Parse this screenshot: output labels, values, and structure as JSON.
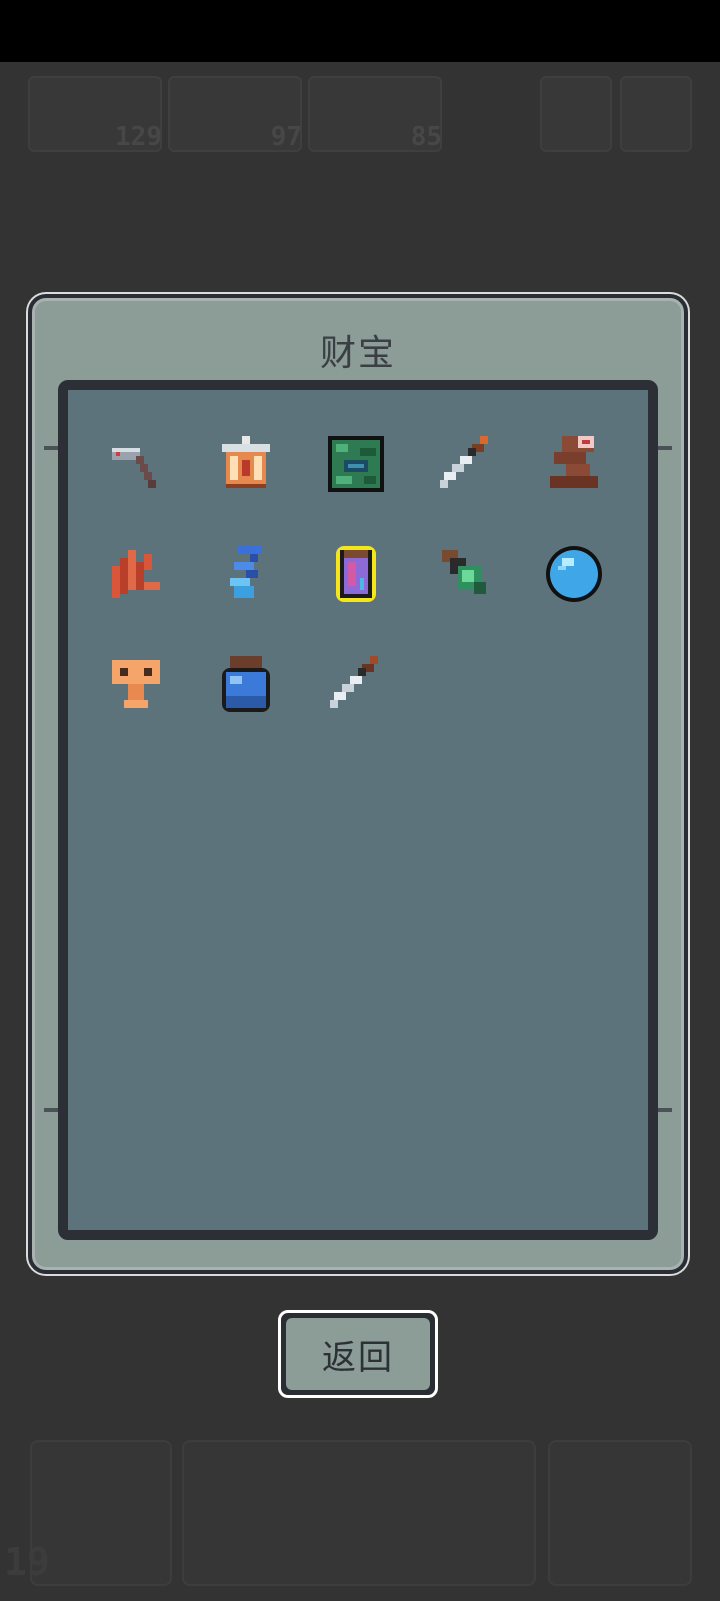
{
  "modal": {
    "title": "财宝"
  },
  "buttons": {
    "back_label": "返回"
  },
  "hud": {
    "counts": [
      "129",
      "97",
      "85"
    ],
    "level": "19"
  },
  "treasure_items": [
    {
      "name": "hammer",
      "selected": false
    },
    {
      "name": "lantern",
      "selected": false
    },
    {
      "name": "green-rune-tile",
      "selected": false
    },
    {
      "name": "dagger",
      "selected": false
    },
    {
      "name": "totem",
      "selected": false
    },
    {
      "name": "red-feathers",
      "selected": false
    },
    {
      "name": "blue-wisp",
      "selected": false
    },
    {
      "name": "purple-jar",
      "selected": true
    },
    {
      "name": "green-vial",
      "selected": false
    },
    {
      "name": "blue-orb",
      "selected": false
    },
    {
      "name": "key-idol",
      "selected": false
    },
    {
      "name": "blue-potion",
      "selected": false
    },
    {
      "name": "dagger",
      "selected": false
    }
  ],
  "colors": {
    "selection": "#f5e51c",
    "panel": "#8c9c96",
    "inner_panel": "#5d737b"
  }
}
